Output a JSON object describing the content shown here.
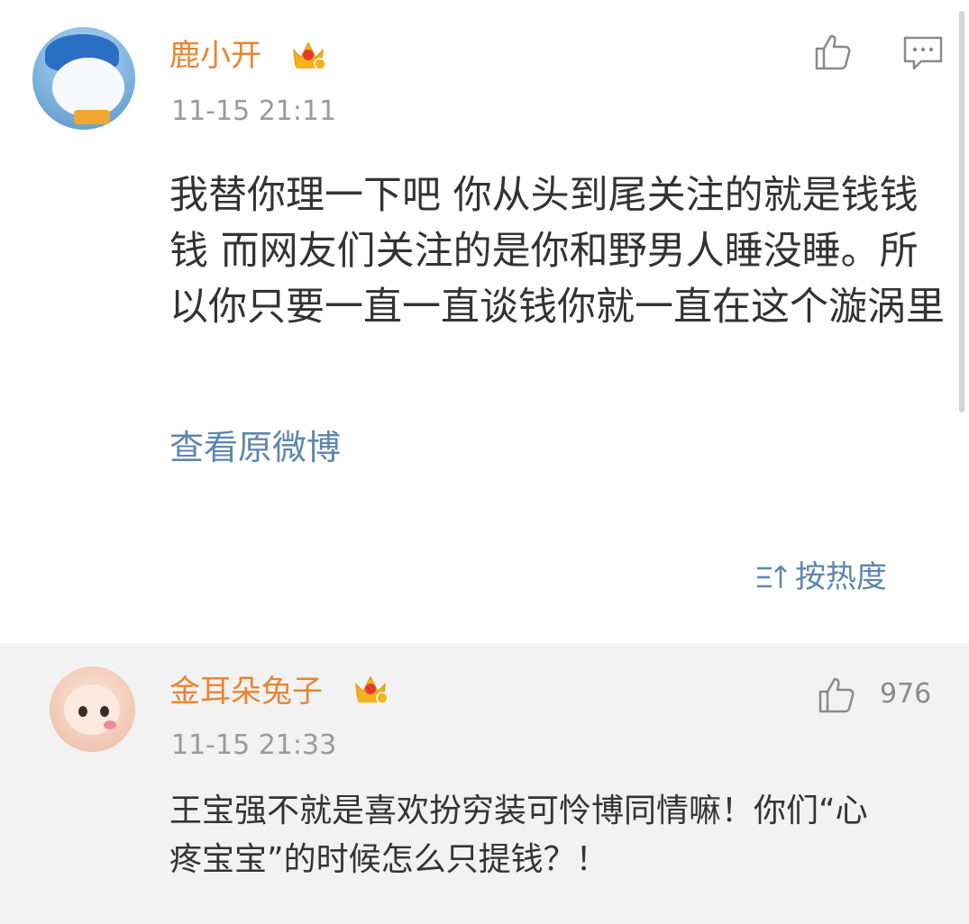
{
  "main_comment": {
    "username": "鹿小开",
    "timestamp": "11-15 21:11",
    "text": "我替你理一下吧 你从头到尾关注的就是钱钱钱 而网友们关注的是你和野男人睡没睡。所以你只要一直一直谈钱你就一直在这个漩涡里",
    "view_original_label": "查看原微博",
    "sort_label": "按热度"
  },
  "reply": {
    "username": "金耳朵兔子",
    "timestamp": "11-15 21:33",
    "like_count": "976",
    "text": "王宝强不就是喜欢扮穷装可怜博同情嘛！你们“心疼宝宝”的时候怎么只提钱？！"
  },
  "colors": {
    "username": "#e8842f",
    "link": "#5d86ad",
    "timestamp": "#9a9a9a",
    "body_text": "#333333",
    "reply_background": "#f2f2f2",
    "icon": "#8a8a8a"
  },
  "icons": {
    "like": "thumbs-up-icon",
    "comment": "comment-icon",
    "crown": "crown-badge-icon",
    "sort": "sort-icon"
  }
}
